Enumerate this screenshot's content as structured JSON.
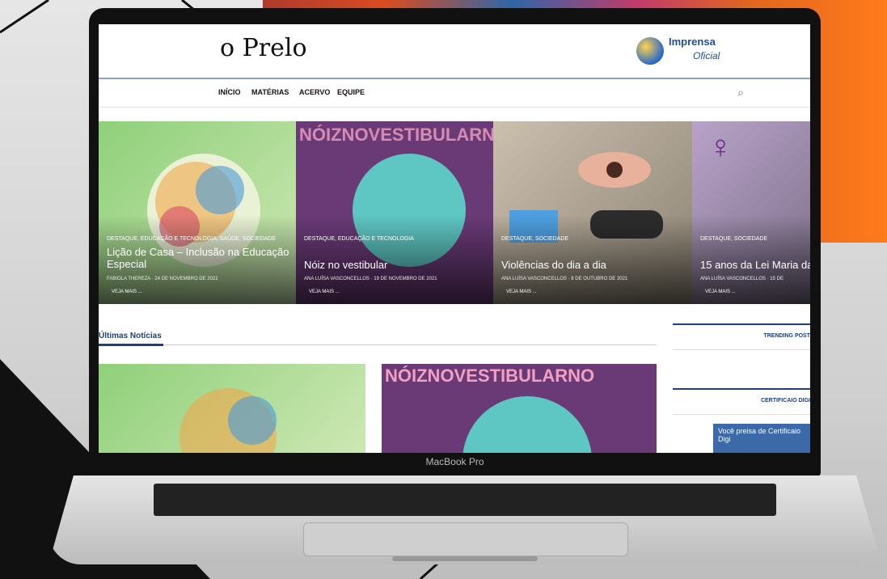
{
  "device": {
    "brand": "MacBook Pro"
  },
  "site": {
    "logo": "o Prelo",
    "partner": {
      "line1": "Imprensa",
      "line2": "Oficial"
    },
    "nav": [
      "INÍCIO",
      "MATÉRIAS",
      "ACERVO",
      "EQUIPE"
    ],
    "colors": {
      "accent": "#1f3e7a"
    }
  },
  "hero": [
    {
      "category": "DESTAQUE, EDUCAÇÃO E TECNOLOGIA, SAÚDE, SOCIEDADE",
      "title": "Lição de Casa – Inclusão na Educação Especial",
      "author": "FABIOLA THEREZA",
      "date": "24 DE NOVEMBRO DE 2021",
      "more": "VEJA MAIS ..."
    },
    {
      "category": "DESTAQUE, EDUCAÇÃO E TECNOLOGIA",
      "title": "Nóiz no vestibular",
      "author": "ANA LUÍSA VASCONCELLOS",
      "date": "19 DE NOVEMBRO DE 2021",
      "more": "VEJA MAIS ..."
    },
    {
      "category": "DESTAQUE, SOCIEDADE",
      "title": "Violências do dia a dia",
      "author": "ANA LUÍSA VASCONCELLOS",
      "date": "8 DE OUTUBRO DE 2021",
      "more": "VEJA MAIS ..."
    },
    {
      "category": "DESTAQUE, SOCIEDADE",
      "title": "15 anos da Lei Maria da",
      "author": "ANA LUÍSA VASCONCELLOS",
      "date": "15 DE",
      "more": "VEJA MAIS ..."
    }
  ],
  "latest": {
    "title": "Últimas Notícias"
  },
  "sidebar": {
    "trending": "TRENDING POST",
    "cert_title": "CERTIFICAIO DIGI",
    "cert_text": "Você preisa de Certificaio Digi"
  },
  "poster_text": "NÓIZNOVESTIBULARNO"
}
